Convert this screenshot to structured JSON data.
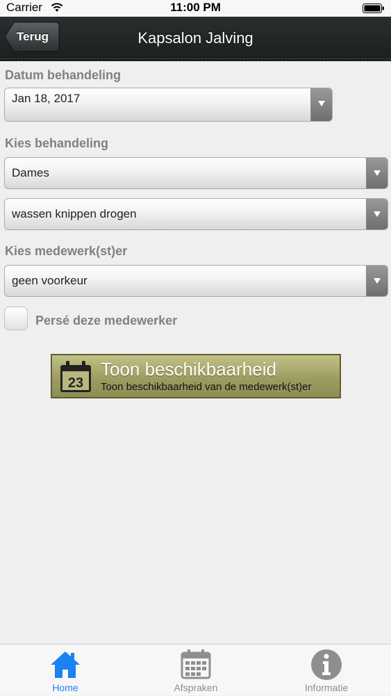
{
  "status": {
    "carrier": "Carrier",
    "time": "11:00 PM"
  },
  "nav": {
    "back_label": "Terug",
    "title": "Kapsalon Jalving"
  },
  "form": {
    "date_label": "Datum behandeling",
    "date_value": "Jan 18, 2017",
    "treatment_label": "Kies behandeling",
    "category_value": "Dames",
    "treatment_value": "wassen knippen drogen",
    "employee_label": "Kies medewerk(st)er",
    "employee_value": "geen voorkeur",
    "persist_label": "Persé deze medewerker"
  },
  "availability": {
    "icon_day": "23",
    "title": "Toon beschikbaarheid",
    "subtitle": "Toon beschikbaarheid van de medewerk(st)er"
  },
  "tabs": [
    {
      "label": "Home",
      "icon": "home-icon",
      "active": true
    },
    {
      "label": "Afspraken",
      "icon": "calendar-icon",
      "active": false
    },
    {
      "label": "Informatie",
      "icon": "info-icon",
      "active": false
    }
  ],
  "colors": {
    "accent": "#1b82f1",
    "nav_bg": "#1c1f1f",
    "button_olive": "#9d9d62"
  }
}
